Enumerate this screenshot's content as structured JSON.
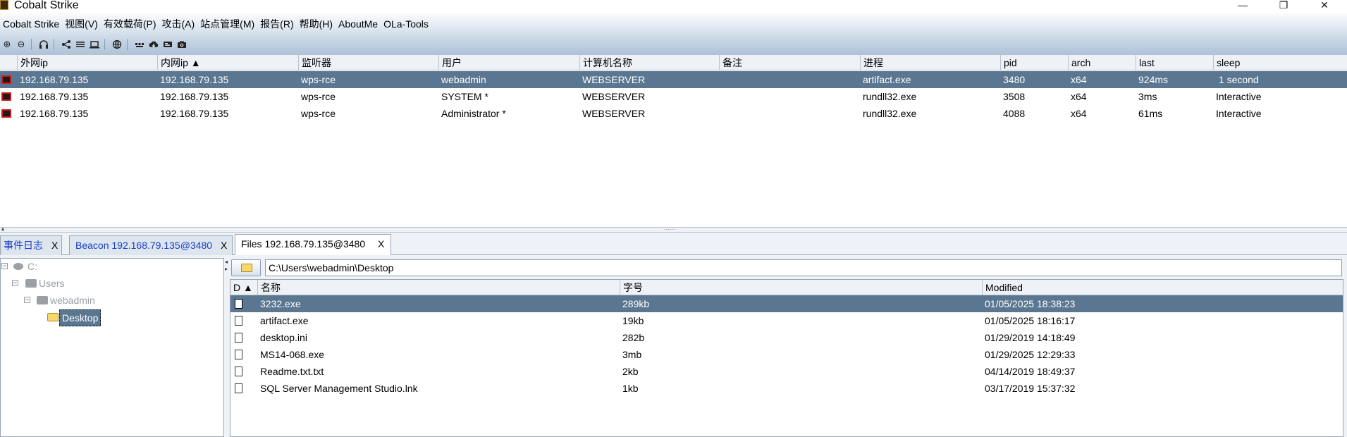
{
  "window": {
    "title": "Cobalt Strike",
    "minimize_glyph": "—",
    "maximize_glyph": "❐",
    "close_glyph": "✕"
  },
  "menu": [
    "Cobalt Strike",
    "视图(V)",
    "有效载荷(P)",
    "攻击(A)",
    "站点管理(M)",
    "报告(R)",
    "帮助(H)",
    "AboutMe",
    "OLa-Tools"
  ],
  "toolbar": {
    "icons": [
      "connect-icon",
      "disconnect-icon",
      "headphones-icon",
      "pivot-graph-icon",
      "session-list-icon",
      "target-list-icon",
      "web-log-icon",
      "keystrokes-icon",
      "download-cloud-icon",
      "credentials-icon",
      "screenshot-icon"
    ]
  },
  "beacons": {
    "columns": [
      "外网ip",
      "内网ip ▲",
      "监听器",
      "用户",
      "计算机名称",
      "备注",
      "进程",
      "pid",
      "arch",
      "last",
      "sleep"
    ],
    "rows": [
      [
        "192.168.79.135",
        "192.168.79.135",
        "wps-rce",
        "webadmin",
        "WEBSERVER",
        "",
        "artifact.exe",
        "3480",
        "x64",
        "924ms",
        " 1 second"
      ],
      [
        "192.168.79.135",
        "192.168.79.135",
        "wps-rce",
        "SYSTEM *",
        "WEBSERVER",
        "",
        "rundll32.exe",
        "3508",
        "x64",
        "3ms",
        "Interactive"
      ],
      [
        "192.168.79.135",
        "192.168.79.135",
        "wps-rce",
        "Administrator *",
        "WEBSERVER",
        "",
        "rundll32.exe",
        "4088",
        "x64",
        "61ms",
        "Interactive"
      ]
    ],
    "selected_index": 0
  },
  "tabs": [
    {
      "label": "事件日志",
      "close": "X"
    },
    {
      "label": "Beacon 192.168.79.135@3480",
      "close": "X"
    },
    {
      "label": "Files 192.168.79.135@3480",
      "close": "X"
    }
  ],
  "tree": {
    "drive": "C:",
    "users": "Users",
    "user": "webadmin",
    "desktop": "Desktop",
    "collapse_glyph": "−"
  },
  "path": {
    "value": "C:\\Users\\webadmin\\Desktop"
  },
  "files": {
    "columns": [
      "D ▲",
      "名称",
      "字号",
      "Modified"
    ],
    "rows": [
      [
        "3232.exe",
        "289kb",
        "01/05/2025 18:38:23"
      ],
      [
        "artifact.exe",
        "19kb",
        "01/05/2025 18:16:17"
      ],
      [
        "desktop.ini",
        "282b",
        "01/29/2019 14:18:49"
      ],
      [
        "MS14-068.exe",
        "3mb",
        "01/29/2025 12:29:33"
      ],
      [
        "Readme.txt.txt",
        "2kb",
        "04/14/2019 18:49:37"
      ],
      [
        "SQL Server Management Studio.lnk",
        "1kb",
        "03/17/2019 15:37:32"
      ]
    ],
    "selected_index": 0
  },
  "colors": {
    "selection": "#5b7691",
    "tab_link": "#1a3cc8",
    "menubar_gradient_end": "#aec3d8"
  }
}
